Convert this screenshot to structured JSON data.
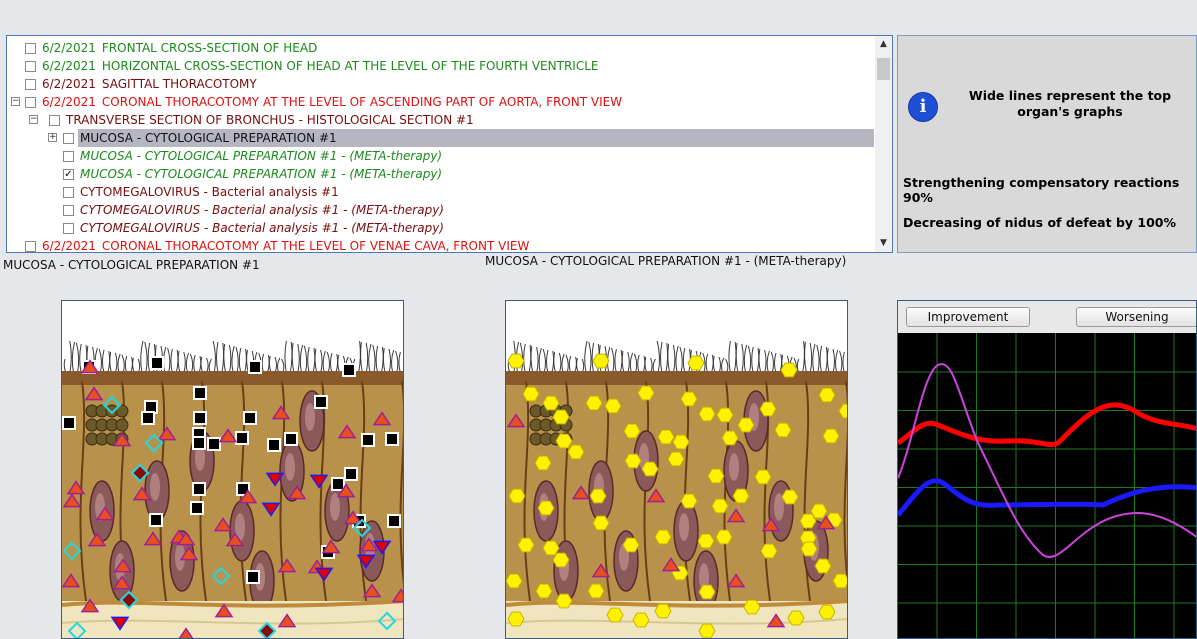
{
  "tree": {
    "rows": [
      {
        "date": "6/2/2021",
        "text": "FRONTAL CROSS-SECTION OF HEAD",
        "color": "green",
        "italic": false,
        "level": 0,
        "checked": false,
        "expander": "",
        "selected": false
      },
      {
        "date": "6/2/2021",
        "text": "HORIZONTAL CROSS-SECTION OF HEAD AT THE LEVEL OF THE FOURTH VENTRICLE",
        "color": "green",
        "italic": false,
        "level": 0,
        "checked": false,
        "expander": "",
        "selected": false
      },
      {
        "date": "6/2/2021",
        "text": "SAGITTAL THORACOTOMY",
        "color": "dark",
        "italic": false,
        "level": 0,
        "checked": false,
        "expander": "",
        "selected": false
      },
      {
        "date": "6/2/2021",
        "text": "CORONAL THORACOTOMY AT THE LEVEL OF ASCENDING PART OF AORTA, FRONT VIEW",
        "color": "red",
        "italic": false,
        "level": 0,
        "checked": false,
        "expander": "−",
        "selected": false
      },
      {
        "date": "",
        "text": "TRANSVERSE SECTION OF BRONCHUS - HISTOLOGICAL SECTION #1",
        "color": "dark",
        "italic": false,
        "level": 1,
        "checked": false,
        "expander": "−",
        "selected": false
      },
      {
        "date": "",
        "text": "MUCOSA - CYTOLOGICAL PREPARATION #1",
        "color": "black",
        "italic": false,
        "level": 2,
        "checked": false,
        "expander": "+",
        "selected": true
      },
      {
        "date": "",
        "text": "MUCOSA - CYTOLOGICAL PREPARATION #1 - (META-therapy)",
        "color": "green",
        "italic": true,
        "level": 2,
        "checked": false,
        "expander": "",
        "selected": false
      },
      {
        "date": "",
        "text": "MUCOSA - CYTOLOGICAL PREPARATION #1 - (META-therapy)",
        "color": "green",
        "italic": true,
        "level": 2,
        "checked": true,
        "expander": "",
        "selected": false
      },
      {
        "date": "",
        "text": "CYTOMEGALOVIRUS - Bacterial analysis #1",
        "color": "dark",
        "italic": false,
        "level": 2,
        "checked": false,
        "expander": "",
        "selected": false
      },
      {
        "date": "",
        "text": "CYTOMEGALOVIRUS - Bacterial analysis #1 - (META-therapy)",
        "color": "dark",
        "italic": true,
        "level": 2,
        "checked": false,
        "expander": "",
        "selected": false
      },
      {
        "date": "",
        "text": "CYTOMEGALOVIRUS - Bacterial analysis #1 - (META-therapy)",
        "color": "dark",
        "italic": true,
        "level": 2,
        "checked": false,
        "expander": "",
        "selected": false
      },
      {
        "date": "6/2/2021",
        "text": "CORONAL THORACOTOMY AT THE LEVEL OF VENAE CAVA, FRONT VIEW",
        "color": "red",
        "italic": false,
        "level": 0,
        "checked": false,
        "expander": "",
        "selected": false
      }
    ],
    "scroll_up_icon": "chevron-up-icon",
    "scroll_down_icon": "chevron-down-icon"
  },
  "info": {
    "icon": "info-icon",
    "icon_glyph": "i",
    "title": "Wide lines represent the top organ's graphs",
    "line1": "Strengthening compensatory reactions 90%",
    "line2": "Decreasing of nidus of defeat by 100%"
  },
  "captions": {
    "left": "MUCOSA - CYTOLOGICAL PREPARATION #1",
    "right": "MUCOSA - CYTOLOGICAL PREPARATION #1 - (META-therapy)"
  },
  "graph": {
    "improvement_label": "Improvement",
    "worsening_label": "Worsening",
    "grid_color": "#1f7a1f",
    "background": "#000000",
    "series_colors": [
      "#ff0000",
      "#1a1aff",
      "#cc44dd"
    ]
  },
  "colors": {
    "green": "#1b8a1b",
    "red": "#e01010",
    "dark": "#7a0d0d",
    "marker_red": "#e8501a",
    "marker_cyan": "#22d8e0",
    "marker_yellow": "#fff200"
  }
}
